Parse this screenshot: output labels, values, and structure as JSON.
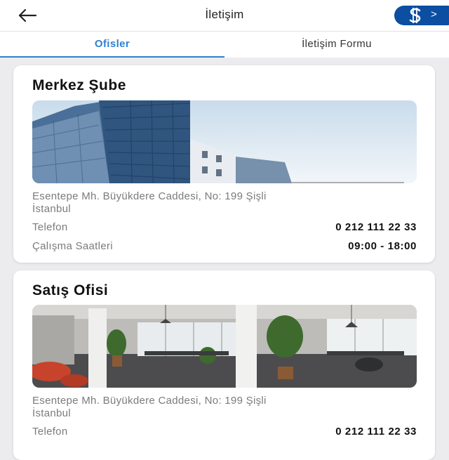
{
  "header": {
    "title": "İletişim",
    "back_icon": "arrow-left-icon",
    "brand_chevron": ">",
    "brand_color": "#0b4ea2"
  },
  "tabs": [
    {
      "label": "Ofisler",
      "active": true
    },
    {
      "label": "İletişim Formu",
      "active": false
    }
  ],
  "accent_color": "#2f80d3",
  "offices": [
    {
      "name": "Merkez Şube",
      "address_line1": "Esentepe Mh. Büyükdere Caddesi, No: 199 Şişli",
      "address_line2": "İstanbul",
      "phone_label": "Telefon",
      "phone": "0 212 111 22 33",
      "hours_label": "Çalışma Saatleri",
      "hours": "09:00 - 18:00"
    },
    {
      "name": "Satış Ofisi",
      "address_line1": "Esentepe Mh. Büyükdere Caddesi, No: 199 Şişli",
      "address_line2": "İstanbul",
      "phone_label": "Telefon",
      "phone": "0 212 111 22 33"
    }
  ]
}
